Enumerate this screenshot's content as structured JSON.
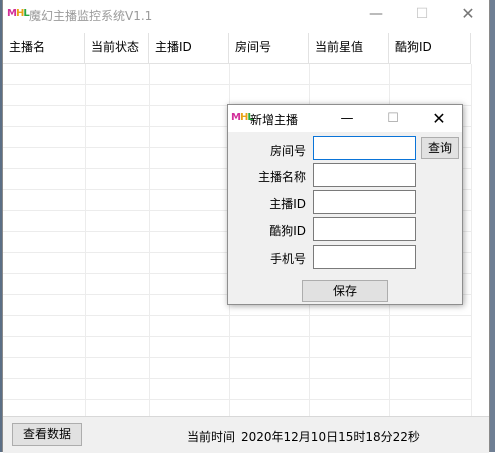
{
  "app": {
    "logo_text": [
      "M",
      "H",
      "L"
    ],
    "title": "魔幻主播监控系统V1.1"
  },
  "window_controls": {
    "minimize": "—",
    "maximize": "☐",
    "close": "✕"
  },
  "grid": {
    "columns": [
      "主播名",
      "当前状态",
      "主播ID",
      "房间号",
      "当前星值",
      "酷狗ID"
    ]
  },
  "bottom": {
    "view_button": "查看数据",
    "time_label": "当前时间",
    "time_value": "2020年12月10日15时18分22秒"
  },
  "dialog": {
    "title": "新增主播",
    "fields": [
      {
        "label": "房间号",
        "value": ""
      },
      {
        "label": "主播名称",
        "value": ""
      },
      {
        "label": "主播ID",
        "value": ""
      },
      {
        "label": "酷狗ID",
        "value": ""
      },
      {
        "label": "手机号",
        "value": ""
      }
    ],
    "query_button": "查询",
    "save_button": "保存"
  },
  "colors": {
    "logo_m": "#d22f9a",
    "logo_h": "#e8a316",
    "logo_l": "#29a83c",
    "focus_border": "#0a74d8"
  }
}
